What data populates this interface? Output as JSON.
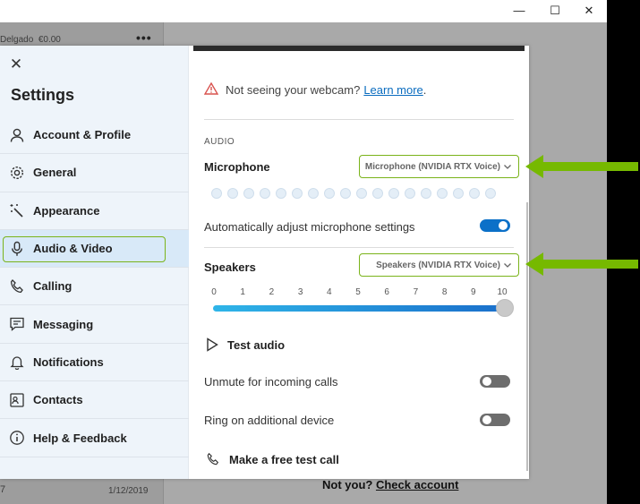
{
  "window": {
    "controls": {
      "minimize": "—",
      "maximize": "☐",
      "close": "✕"
    }
  },
  "background": {
    "contact_name": "Delgado",
    "contact_balance": "€0.00",
    "menu_dots": "•••",
    "date": "1/12/2019",
    "number_fragment": "7",
    "not_you": "Not you?",
    "check_account": "Check account"
  },
  "settings": {
    "title": "Settings",
    "close_icon": "close-icon",
    "nav": [
      {
        "label": "Account & Profile",
        "icon": "person-icon"
      },
      {
        "label": "General",
        "icon": "gear-icon"
      },
      {
        "label": "Appearance",
        "icon": "magic-wand-icon"
      },
      {
        "label": "Audio & Video",
        "icon": "microphone-icon",
        "active": true
      },
      {
        "label": "Calling",
        "icon": "phone-icon"
      },
      {
        "label": "Messaging",
        "icon": "chat-icon"
      },
      {
        "label": "Notifications",
        "icon": "bell-icon"
      },
      {
        "label": "Contacts",
        "icon": "contact-card-icon"
      },
      {
        "label": "Help & Feedback",
        "icon": "info-icon"
      }
    ]
  },
  "audio_video": {
    "webcam_text": "Not seeing your webcam?",
    "learn_more": "Learn more",
    "learn_more_suffix": ".",
    "audio_section": "AUDIO",
    "microphone_label": "Microphone",
    "microphone_device": "Microphone (NVIDIA RTX Voice)",
    "auto_adjust_label": "Automatically adjust microphone settings",
    "auto_adjust_on": true,
    "speakers_label": "Speakers",
    "speakers_device": "Speakers (NVIDIA RTX Voice)",
    "volume_ticks": [
      "0",
      "1",
      "2",
      "3",
      "4",
      "5",
      "6",
      "7",
      "8",
      "9",
      "10"
    ],
    "volume_value": 10,
    "test_audio": "Test audio",
    "unmute_label": "Unmute for incoming calls",
    "unmute_on": false,
    "ring_label": "Ring on additional device",
    "ring_on": false,
    "free_test_call": "Make a free test call"
  },
  "colors": {
    "highlight_green": "#7ab31a",
    "arrow_green": "#76b900",
    "toggle_on": "#0b70c8",
    "link_blue": "#0a6cbf"
  }
}
